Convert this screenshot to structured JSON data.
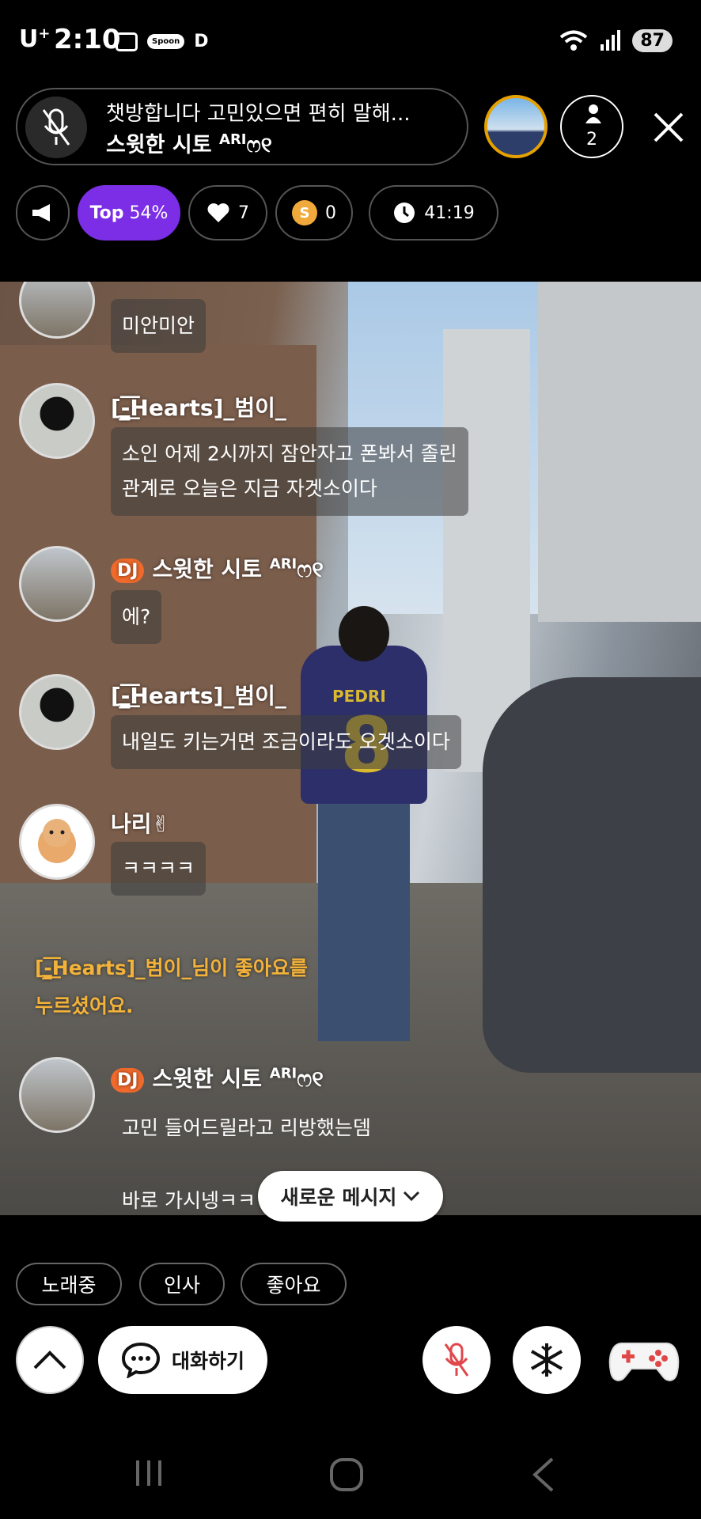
{
  "status_bar": {
    "carrier": "U",
    "carrier_sup": "+",
    "time": "2:10",
    "spoon_label": "Spoon",
    "d_label": "D",
    "battery": "87",
    "wifi_label": "6"
  },
  "header": {
    "room_title": "챗방합니다 고민있으면 편히 말해...",
    "host_name": "스윗한 시토",
    "host_suffix": "ARI",
    "host_deco": "ෆ୧",
    "listener_count": "2"
  },
  "chips": {
    "top_label": "Top",
    "top_value": "54%",
    "hearts": "7",
    "spoons": "0",
    "spoon_coin": "S",
    "timer": "41:19"
  },
  "chat": {
    "messages": [
      {
        "text": "미안미안"
      },
      {
        "nick": "[-̳͟͞Hearts]_범이_",
        "text1": "소인 어제 2시까지 잠안자고 폰봐서 졸린",
        "text2": "관계로 오늘은 지금 자겟소이다"
      },
      {
        "dj": "DJ",
        "nick": "스윗한 시토",
        "suffix": "ARI",
        "deco": "ෆ୧",
        "text": "에?"
      },
      {
        "nick": "[-̳͟͞Hearts]_범이_",
        "text": "내일도 키는거면 조금이라도 오겟소이다"
      },
      {
        "nick": "나리✌︎",
        "text": "ㅋㅋㅋㅋ"
      },
      {
        "dj": "DJ",
        "nick": "스윗한 시토",
        "suffix": "ARI",
        "deco": "ෆ୧",
        "text1": "고민 들어드릴라고 리방했는뎀",
        "text2": "바로 가시넹ㅋㅋ"
      }
    ],
    "system_line1": "[-̳͟͞Hearts]_범이_님이 좋아요를",
    "system_line2": "누르셨어요.",
    "new_message": "새로운 메시지",
    "shirt_name": "PEDRI",
    "shirt_number": "8"
  },
  "quick_replies": [
    "노래중",
    "인사",
    "좋아요"
  ],
  "controls": {
    "chat_label": "대화하기"
  },
  "icons": {
    "mic_off": "mic-off-icon",
    "listener": "person-icon",
    "close": "close-icon",
    "megaphone": "megaphone-icon",
    "heart": "heart-icon",
    "clock": "clock-icon",
    "chevron_up": "chevron-up-icon",
    "chat": "chat-bubble-icon",
    "snowflake": "snowflake-icon",
    "gamepad": "gamepad-icon"
  },
  "colors": {
    "accent_purple": "#7b2ee6",
    "dj_badge": "#ef6a2b",
    "system_message": "#f3b23a",
    "mic_off_red": "#e0474c"
  }
}
